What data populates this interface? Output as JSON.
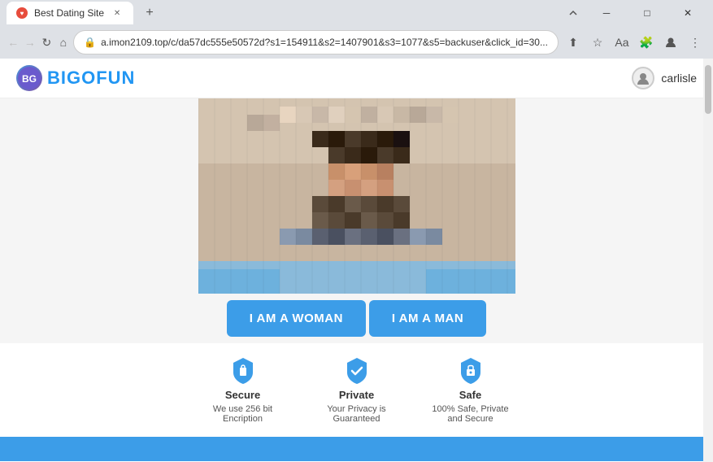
{
  "browser": {
    "tab": {
      "title": "Best Dating Site",
      "favicon": "♥"
    },
    "new_tab_label": "+",
    "controls": {
      "minimize": "─",
      "maximize": "□",
      "close": "✕"
    },
    "toolbar": {
      "back": "←",
      "forward": "→",
      "refresh": "↻",
      "home": "⌂",
      "address": "a.imon2109.top/c/da57dc555e50572d?s1=154911&s2=1407901&s3=1077&s5=backuser&click_id=30...",
      "share": "⬆",
      "bookmark": "☆",
      "read": "Aa",
      "extensions": "🧩",
      "more": "⋮"
    }
  },
  "site": {
    "logo_text": "BIGOFUN",
    "username": "carlisle",
    "buttons": {
      "woman": "I AM A WOMAN",
      "man": "I AM A MAN"
    },
    "trust": [
      {
        "title": "Secure",
        "description": "We use 256 bit Encription",
        "icon": "secure"
      },
      {
        "title": "Private",
        "description": "Your Privacy is Guaranteed",
        "icon": "private"
      },
      {
        "title": "Safe",
        "description": "100% Safe, Private and Secure",
        "icon": "safe"
      }
    ]
  }
}
